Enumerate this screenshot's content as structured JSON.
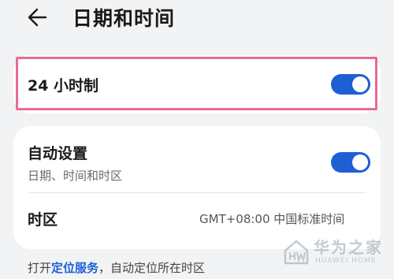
{
  "header": {
    "back_icon": "arrow-left-icon",
    "title": "日期和时间"
  },
  "settings": {
    "hour24": {
      "label": "24 小时制",
      "enabled": true
    },
    "auto_set": {
      "label": "自动设置",
      "subtitle": "日期、时间和时区",
      "enabled": true
    },
    "timezone": {
      "label": "时区",
      "value": "GMT+08:00 中国标准时间"
    }
  },
  "footer": {
    "prefix": "打开",
    "link": "定位服务",
    "suffix": "，自动定位所在时区"
  },
  "watermark": {
    "title": "华为之家",
    "subtitle": "HUAWEI.HOME"
  },
  "colors": {
    "accent": "#1e5fd6",
    "highlight": "#ea6a95",
    "background": "#f1f3f5"
  }
}
